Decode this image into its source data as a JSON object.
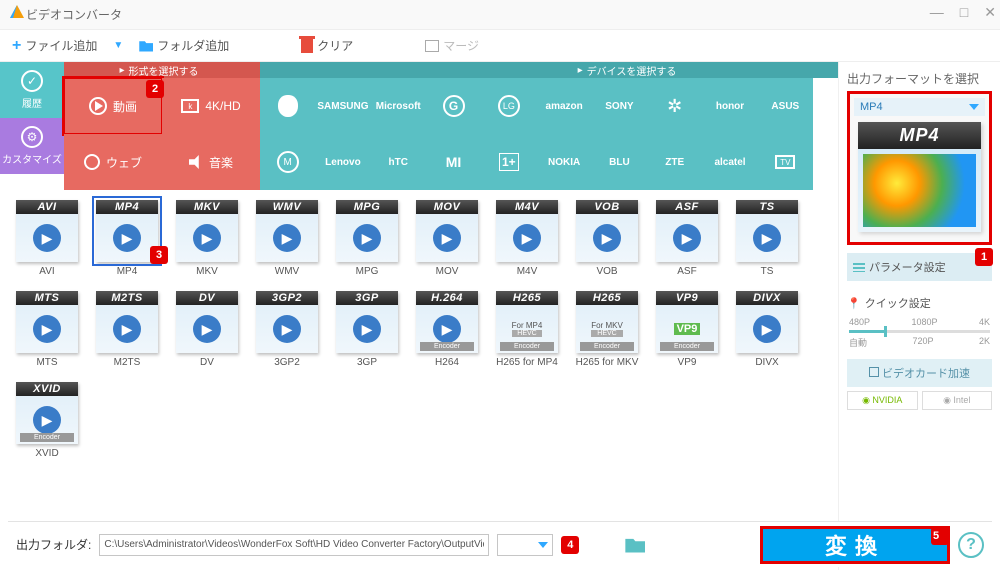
{
  "window": {
    "title": "ビデオコンバータ"
  },
  "toolbar": {
    "add_file": "ファイル追加",
    "add_folder": "フォルダ追加",
    "clear": "クリア",
    "merge": "マージ"
  },
  "side": {
    "history": "履歴",
    "customize": "カスタマイズ"
  },
  "cat_header": {
    "format": "形式を選択する",
    "device": "デバイスを選択する"
  },
  "categories": {
    "video": "動画",
    "fourk": "4K/HD",
    "web": "ウェブ",
    "audio": "音楽"
  },
  "brands": [
    "Apple",
    "SAMSUNG",
    "Microsoft",
    "G",
    "LG",
    "amazon",
    "SONY",
    "HUAWEI",
    "honor",
    "ASUS",
    "Moto",
    "Lenovo",
    "hTC",
    "MI",
    "OnePlus",
    "NOKIA",
    "BLU",
    "ZTE",
    "alcatel",
    "TV"
  ],
  "formats": [
    {
      "tag": "AVI",
      "label": "AVI"
    },
    {
      "tag": "MP4",
      "label": "MP4",
      "selected": true
    },
    {
      "tag": "MKV",
      "label": "MKV"
    },
    {
      "tag": "WMV",
      "label": "WMV"
    },
    {
      "tag": "MPG",
      "label": "MPG"
    },
    {
      "tag": "MOV",
      "label": "MOV"
    },
    {
      "tag": "M4V",
      "label": "M4V"
    },
    {
      "tag": "VOB",
      "label": "VOB"
    },
    {
      "tag": "ASF",
      "label": "ASF"
    },
    {
      "tag": "TS",
      "label": "TS"
    },
    {
      "tag": "MTS",
      "label": "MTS"
    },
    {
      "tag": "M2TS",
      "label": "M2TS"
    },
    {
      "tag": "DV",
      "label": "DV"
    },
    {
      "tag": "3GP2",
      "label": "3GP2"
    },
    {
      "tag": "3GP",
      "label": "3GP"
    },
    {
      "tag": "H.264",
      "label": "H264",
      "enc": "Encoder"
    },
    {
      "tag": "H265",
      "label": "H265 for MP4",
      "sub": "For MP4",
      "hevc": true,
      "enc": "Encoder"
    },
    {
      "tag": "H265",
      "label": "H265 for MKV",
      "sub": "For MKV",
      "hevc": true,
      "enc": "Encoder"
    },
    {
      "tag": "VP9",
      "label": "VP9",
      "vp9": true,
      "enc": "Encoder"
    },
    {
      "tag": "DIVX",
      "label": "DIVX"
    },
    {
      "tag": "XVID",
      "label": "XVID",
      "enc": "Encoder"
    }
  ],
  "right": {
    "title": "出力フォーマットを選択",
    "preview_label": "MP4",
    "thumb_tag": "MP4",
    "param": "パラメータ設定",
    "quick": "クイック設定",
    "resolutions_top": [
      "480P",
      "1080P",
      "4K"
    ],
    "resolutions_bottom": [
      "自動",
      "720P",
      "2K"
    ],
    "gpu": "ビデオカード加速",
    "vendors": {
      "nvidia": "NVIDIA",
      "intel": "Intel"
    }
  },
  "bottom": {
    "label": "出力フォルダ:",
    "path": "C:\\Users\\Administrator\\Videos\\WonderFox Soft\\HD Video Converter Factory\\OutputVideo\\",
    "convert": "変換"
  },
  "badges": {
    "1": "1",
    "2": "2",
    "3": "3",
    "4": "4",
    "5": "5"
  }
}
